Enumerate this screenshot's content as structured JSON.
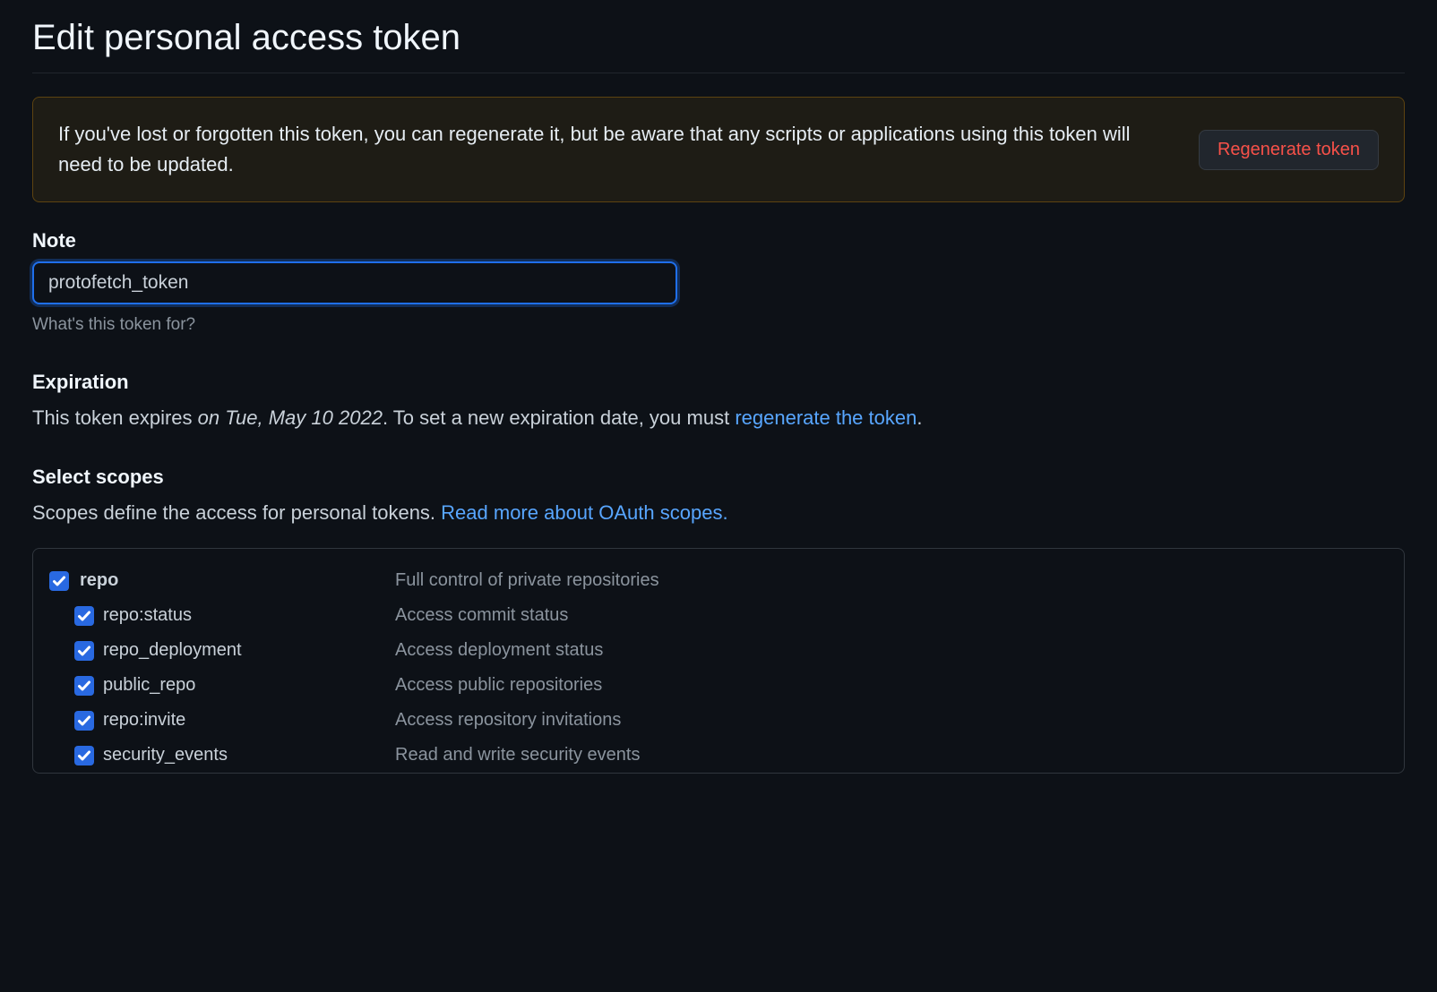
{
  "page_title": "Edit personal access token",
  "warning": {
    "text": "If you've lost or forgotten this token, you can regenerate it, but be aware that any scripts or applications using this token will need to be updated.",
    "button_label": "Regenerate token"
  },
  "note": {
    "label": "Note",
    "value": "protofetch_token",
    "hint": "What's this token for?"
  },
  "expiration": {
    "label": "Expiration",
    "prefix": "This token expires ",
    "date": "on Tue, May 10 2022",
    "mid": ". To set a new expiration date, you must ",
    "link": "regenerate the token",
    "suffix": "."
  },
  "scopes": {
    "label": "Select scopes",
    "description_prefix": "Scopes define the access for personal tokens. ",
    "description_link": "Read more about OAuth scopes.",
    "items": [
      {
        "name": "repo",
        "description": "Full control of private repositories",
        "checked": true,
        "parent": true
      },
      {
        "name": "repo:status",
        "description": "Access commit status",
        "checked": true,
        "parent": false
      },
      {
        "name": "repo_deployment",
        "description": "Access deployment status",
        "checked": true,
        "parent": false
      },
      {
        "name": "public_repo",
        "description": "Access public repositories",
        "checked": true,
        "parent": false
      },
      {
        "name": "repo:invite",
        "description": "Access repository invitations",
        "checked": true,
        "parent": false
      },
      {
        "name": "security_events",
        "description": "Read and write security events",
        "checked": true,
        "parent": false
      }
    ]
  }
}
